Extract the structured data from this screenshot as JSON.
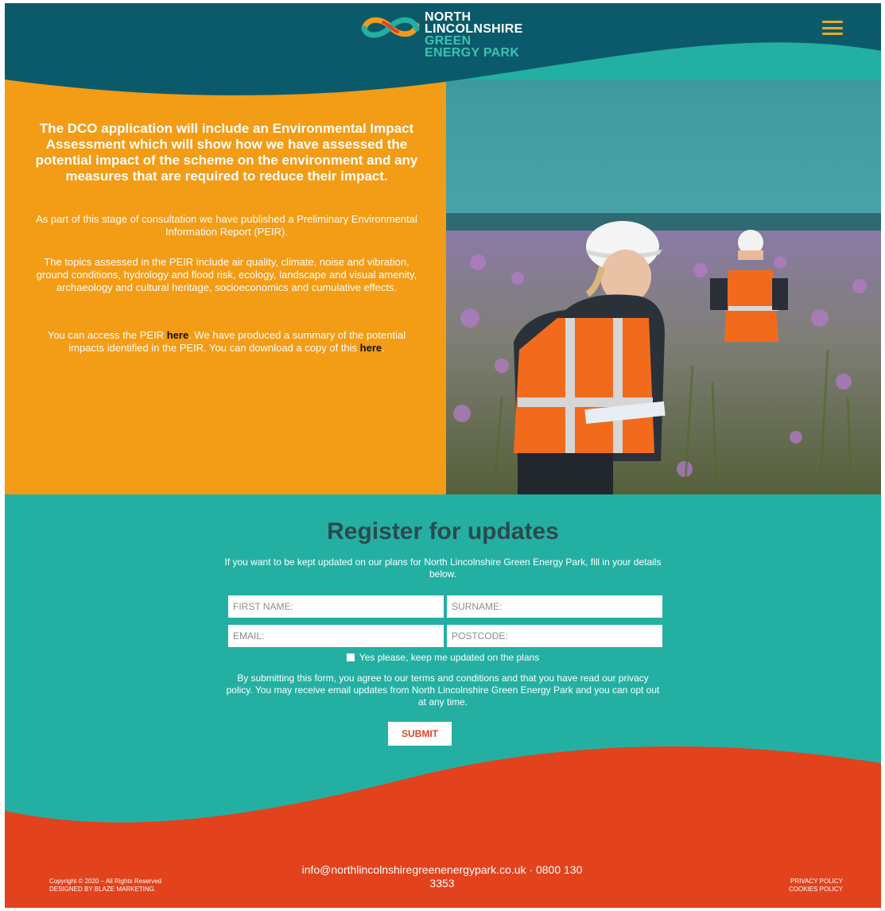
{
  "colors": {
    "header_bg": "#0b5a6b",
    "orange": "#f39c16",
    "teal": "#23b0a3",
    "footer_red": "#e2421c",
    "title_dark": "#2c4a4e",
    "hamburger": "#f4a81d"
  },
  "header": {
    "logo": {
      "line1": "NORTH",
      "line2": "LINCOLNSHIRE",
      "line3": "GREEN",
      "line4": "ENERGY PARK"
    },
    "menu_icon": "hamburger-menu-icon"
  },
  "intro": {
    "heading": "The DCO application will include an Environmental Impact Assessment which will show how we have assessed the potential impact of the scheme on the environment and any measures that are required to reduce their impact.",
    "para1": "As part of this stage of consultation we have published a Preliminary Environmental Information Report (PEIR).",
    "para2": "The topics assessed in the PEIR include air quality, climate, noise and vibration, ground conditions, hydrology and flood risk, ecology, landscape and visual amenity, archaeology and cultural heritage, socioeconomics and cumulative effects.",
    "para3_a": "You can access the PEIR ",
    "link1": "here",
    "para3_b": ". We have produced a summary of the potential impacts identified in the PEIR. You can download a copy of this ",
    "link2": "here",
    "para3_c": "."
  },
  "register": {
    "title": "Register for updates",
    "subtitle": "If you want to be kept updated on our plans for North Lincolnshire Green Energy Park, fill in your details below.",
    "first_name_placeholder": "FIRST NAME:",
    "surname_placeholder": "SURNAME:",
    "email_placeholder": "EMAIL:",
    "postcode_placeholder": "POSTCODE:",
    "checkbox_label": "Yes please, keep me updated on the plans",
    "terms": "By submitting this form, you agree to our terms and conditions and that you have read our privacy policy. You may receive email updates from North Lincolnshire Green Energy Park and you can opt out at any time.",
    "submit_label": "SUBMIT"
  },
  "footer": {
    "copyright": "Copyright © 2020 – All Rights Reserved",
    "designed_by": "DESIGNED BY BLAZE MARKETING.",
    "contact_line1": "info@northlincolnshiregreenenergypark.co.uk · 0800 130",
    "contact_line2": "3353",
    "privacy": "PRIVACY POLICY",
    "cookies": "COOKIES POLICY"
  }
}
